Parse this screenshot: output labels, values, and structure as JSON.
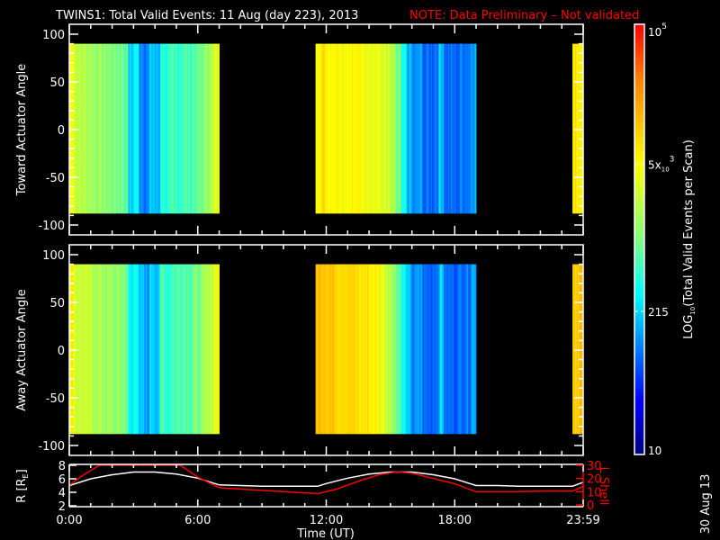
{
  "title": {
    "main": "TWINS1: Total Valid Events: 11 Aug (day 223), 2013",
    "note": "NOTE: Data Preliminary – Not validated",
    "note_color": "#ff0000"
  },
  "footer_date": "30 Aug 13",
  "chart_data": [
    {
      "type": "heatmap",
      "name": "toward",
      "ylabel": "Toward Actuator Angle",
      "ylim": [
        -110,
        110
      ],
      "yticks": [
        "100",
        "50",
        "0",
        "-50",
        "-100"
      ],
      "ytick_values": [
        100,
        50,
        0,
        -50,
        -100
      ],
      "angle_range": [
        -88,
        90
      ],
      "bin_hours": 0.25,
      "segments": [
        {
          "start": 0.0,
          "values": [
            3.7,
            3.35,
            3.3,
            3.25,
            3.2,
            3.15,
            3.1,
            3.05,
            3.0,
            3.0,
            2.9,
            2.3,
            2.5,
            2.1,
            2.0,
            2.3,
            2.2,
            2.7,
            2.6,
            2.7,
            2.75,
            2.8,
            2.8,
            2.85,
            2.9,
            3.1,
            3.3,
            3.5
          ]
        },
        {
          "start": 11.5,
          "values": [
            3.8,
            3.85,
            3.8,
            3.8,
            3.75,
            3.8,
            3.75,
            3.7,
            3.7,
            3.7,
            3.65,
            3.6,
            3.5,
            3.4,
            3.2,
            2.9,
            2.5,
            2.2,
            2.0,
            2.1,
            1.9,
            1.9,
            2.0,
            2.3,
            1.9,
            1.9,
            1.9,
            2.0,
            2.0,
            2.2
          ]
        },
        {
          "start": 23.5,
          "values": [
            3.8,
            3.85
          ]
        }
      ]
    },
    {
      "type": "heatmap",
      "name": "away",
      "ylabel": "Away Actuator Angle",
      "ylim": [
        -110,
        110
      ],
      "yticks": [
        "100",
        "50",
        "0",
        "-50",
        "-100"
      ],
      "ytick_values": [
        100,
        50,
        0,
        -50,
        -100
      ],
      "angle_range": [
        -88,
        90
      ],
      "bin_hours": 0.25,
      "segments": [
        {
          "start": 0.0,
          "values": [
            3.75,
            3.45,
            3.4,
            3.35,
            3.3,
            3.25,
            3.2,
            3.15,
            3.1,
            3.1,
            3.0,
            2.4,
            2.6,
            2.2,
            2.1,
            2.4,
            2.3,
            2.8,
            2.7,
            2.8,
            2.85,
            2.9,
            2.9,
            2.95,
            3.0,
            3.2,
            3.4,
            3.6
          ]
        },
        {
          "start": 11.5,
          "values": [
            4.1,
            4.15,
            4.1,
            4.05,
            4.0,
            4.0,
            3.95,
            3.9,
            3.85,
            3.85,
            3.8,
            3.75,
            3.6,
            3.4,
            3.2,
            2.9,
            2.5,
            2.2,
            2.0,
            2.1,
            1.9,
            1.9,
            2.0,
            2.3,
            1.9,
            1.9,
            1.9,
            2.0,
            2.0,
            2.2
          ]
        },
        {
          "start": 23.5,
          "values": [
            4.05,
            4.1
          ]
        }
      ]
    },
    {
      "type": "line",
      "name": "orbit",
      "xlabel": "Time (UT)",
      "xticks": [
        "0:00",
        "6:00",
        "12:00",
        "18:00",
        "23:59"
      ],
      "xtick_values": [
        0,
        6,
        12,
        18,
        24
      ],
      "xlim": [
        0,
        24
      ],
      "ylabel_left": "R [R",
      "ylabel_left_sub": "E",
      "ylabel_left_end": "]",
      "ylim_left": [
        2,
        8
      ],
      "yticks_left": [
        "8",
        "6",
        "4",
        "2"
      ],
      "ytick_values_left": [
        8,
        6,
        4,
        2
      ],
      "ylabel_right": "L Shell",
      "ylim_right": [
        0,
        30
      ],
      "yticks_right": [
        "30",
        "20",
        "10",
        "0"
      ],
      "ytick_values_right": [
        30,
        20,
        10,
        0
      ],
      "series": [
        {
          "name": "R",
          "color": "#ffffff",
          "axis": "left",
          "x": [
            0,
            1,
            2,
            3,
            4,
            5,
            6,
            7,
            8,
            9,
            10,
            11,
            11.6,
            12,
            13,
            14,
            15,
            16,
            17,
            18,
            19,
            20,
            21,
            22,
            23,
            23.5,
            24
          ],
          "y": [
            5.0,
            6.0,
            6.6,
            7.0,
            7.0,
            6.7,
            6.1,
            5.1,
            5.0,
            4.9,
            4.9,
            4.9,
            4.9,
            5.3,
            6.1,
            6.7,
            7.0,
            7.0,
            6.6,
            6.0,
            5.0,
            5.0,
            4.9,
            4.9,
            4.9,
            4.9,
            5.5
          ]
        },
        {
          "name": "L Shell",
          "color": "#ff0000",
          "axis": "right",
          "x": [
            0,
            0.6,
            1.4,
            5.2,
            6.0,
            7.0,
            8.0,
            9.0,
            10.0,
            11.6,
            12.5,
            13.5,
            14.5,
            15.3,
            16.0,
            17.0,
            18.0,
            19.0,
            20.0,
            21.0,
            22.0,
            23.5,
            24.0
          ],
          "y": [
            15,
            22,
            30,
            30,
            21,
            13,
            12,
            11,
            10,
            8.5,
            12,
            18,
            23,
            25,
            24,
            20,
            16,
            10,
            10,
            10,
            10.5,
            10.5,
            14
          ]
        }
      ]
    }
  ],
  "colorbar": {
    "label_main": "LOG",
    "label_sub": "10",
    "label_rest": "(Total Valid Events per Scan)",
    "range_log": [
      1,
      5
    ],
    "ticks": [
      {
        "base": "10",
        "sup": "5",
        "value": 5
      },
      {
        "base": "5x",
        "sub": "10",
        "sup": "3",
        "value": 3.699
      },
      {
        "base": "215",
        "value": 2.332
      },
      {
        "base": "10",
        "value": 1
      }
    ]
  }
}
